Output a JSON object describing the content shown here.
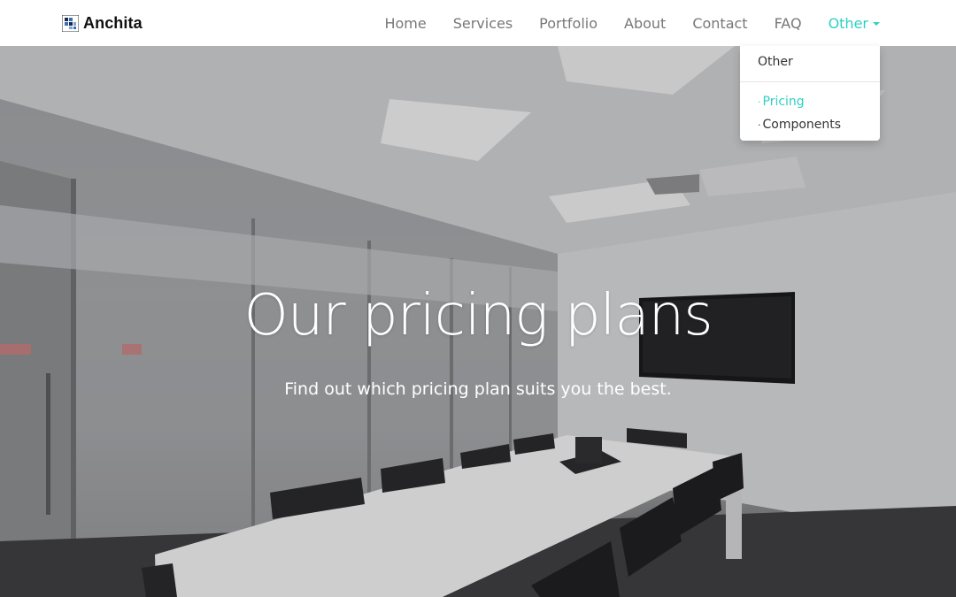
{
  "brand": {
    "name": "Anchita",
    "logo_icon": "pixel-logo-icon"
  },
  "nav": {
    "items": [
      {
        "label": "Home"
      },
      {
        "label": "Services"
      },
      {
        "label": "Portfolio"
      },
      {
        "label": "About"
      },
      {
        "label": "Contact"
      },
      {
        "label": "FAQ"
      }
    ],
    "dropdown_label": "Other",
    "accent_color": "#2fd0c4"
  },
  "dropdown": {
    "header": "Other",
    "items": [
      {
        "label": "Pricing",
        "selected": true
      },
      {
        "label": "Components",
        "selected": false
      }
    ]
  },
  "hero": {
    "title": "Our pricing plans",
    "subtitle": "Find out which pricing plan suits you the best."
  }
}
